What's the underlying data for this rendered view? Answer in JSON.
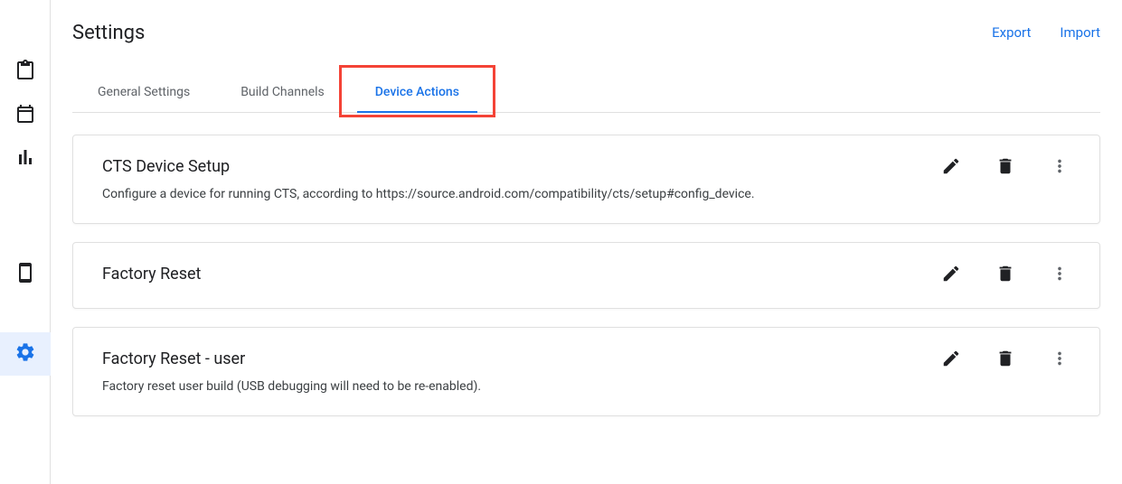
{
  "header": {
    "title": "Settings",
    "export_label": "Export",
    "import_label": "Import"
  },
  "sidebar": {
    "items": [
      {
        "name": "clipboard",
        "active": false
      },
      {
        "name": "calendar",
        "active": false
      },
      {
        "name": "analytics",
        "active": false
      },
      {
        "name": "device",
        "active": false
      },
      {
        "name": "settings",
        "active": true
      }
    ]
  },
  "tabs": [
    {
      "label": "General Settings",
      "active": false
    },
    {
      "label": "Build Channels",
      "active": false
    },
    {
      "label": "Device Actions",
      "active": true
    }
  ],
  "cards": [
    {
      "title": "CTS Device Setup",
      "description": "Configure a device for running CTS, according to https://source.android.com/compatibility/cts/setup#config_device."
    },
    {
      "title": "Factory Reset",
      "description": ""
    },
    {
      "title": "Factory Reset - user",
      "description": "Factory reset user build (USB debugging will need to be re-enabled)."
    }
  ],
  "highlight": {
    "target_tab_index": 2
  }
}
